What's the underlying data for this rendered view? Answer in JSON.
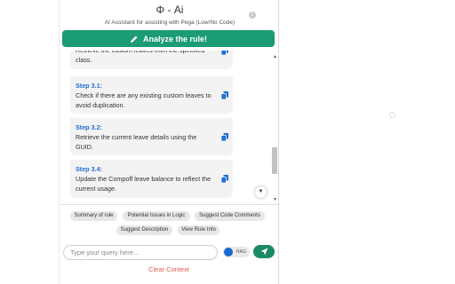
{
  "header": {
    "title": "Φ - Ai",
    "subtitle": "AI Assistant for assisting with Pega (Low/No Code)"
  },
  "analyze_button": {
    "label": "Analyze the rule!"
  },
  "steps": [
    {
      "step": "",
      "text": "Retrieve the custom leaves from the specified class."
    },
    {
      "step": "Step 3.1:",
      "text": "Check if there are any existing custom leaves to avoid duplication."
    },
    {
      "step": "Step 3.2:",
      "text": "Retrieve the current leave details using the GUID."
    },
    {
      "step": "Step 3.4:",
      "text": "Update the Compoff leave balance to reflect the current usage."
    }
  ],
  "chips": [
    "Summary of rule",
    "Potential Issues in Logic",
    "Suggest Code Comments",
    "Suggest Description",
    "View Rule Info"
  ],
  "query": {
    "placeholder": "Type your query here...",
    "value": ""
  },
  "rag": {
    "label": "RAG",
    "enabled": true
  },
  "clear_context": "Clear Context",
  "icons": {
    "analyze": "pencil-icon",
    "copy": "copy-icon",
    "info": "info-icon",
    "send": "send-icon",
    "scroll_down": "chevron-down-icon"
  },
  "colors": {
    "primary_green": "#1b9c74",
    "step_blue": "#1f6fd1",
    "clear_red": "#e05a4e",
    "rag_blue": "#1967d2"
  }
}
